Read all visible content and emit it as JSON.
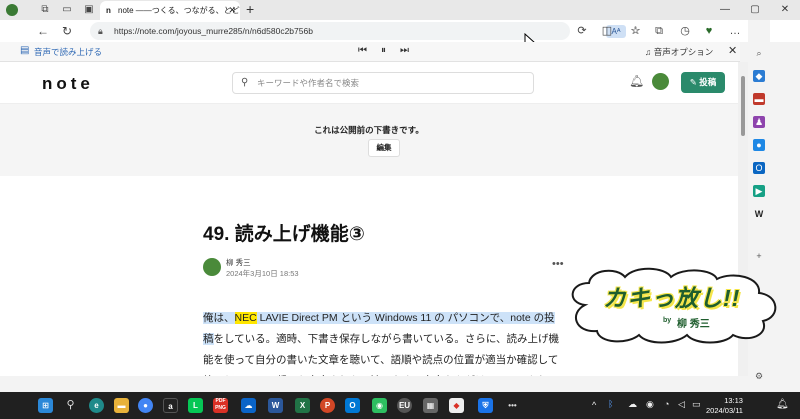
{
  "browser": {
    "tab_title": "note ――つくる、つながる、とどける。",
    "tab_favicon": "n",
    "url": "https://note.com/joyous_murre285/n/n6d580c2b756b",
    "readaloud_icon_text": "Aᴬ"
  },
  "read_aloud_bar": {
    "label": "音声で読み上げる",
    "options_label": "音声オプション"
  },
  "site": {
    "logo": "note",
    "search_placeholder": "キーワードや作者名で検索",
    "post_button": "投稿"
  },
  "draft": {
    "message": "これは公開前の下書きです。",
    "edit_button": "編集"
  },
  "article": {
    "title": "49. 読み上げ機能③",
    "author": "柳 秀三",
    "date": "2024年3月10日 18:53",
    "body_line1_pre": "俺は、",
    "body_line1_nec": "NEC",
    "body_line1_post": " LAVIE Direct PM という Windows 11 の パソコンで、note の投稿",
    "body_rest": "をしている。適時、下書き保存しながら書いている。さらに、読み上げ機能を使って自分の書いた文章を聴いて、語順や読点の位置が適当か確認して校正している。凝った文章よりも、読みやすい文章を心がけているつもりだ。"
  },
  "overlay": {
    "title": "カキっ放し!!",
    "by": "by",
    "author": "柳 秀三"
  },
  "taskbar": {
    "icons": [
      "windows-icon",
      "search-icon",
      "edge-icon",
      "explorer-icon",
      "chrome-icon",
      "amazon-icon",
      "line-icon",
      "pdf-icon",
      "onedrive-icon",
      "word-icon",
      "excel-icon",
      "powerpoint-icon",
      "outlook-icon",
      "evernote-icon",
      "eu-icon",
      "app-icon",
      "maps-icon",
      "security-icon",
      "more-icon"
    ],
    "pdf_label": "PDF\nPNG",
    "eu_label": "EU",
    "time": "13:13",
    "date": "2024/03/11"
  },
  "colors": {
    "accent_green": "#2a8a6b",
    "highlight_blue": "#cde2f8",
    "highlight_yellow": "#ffe600",
    "overlay_green": "#1f5e2e",
    "overlay_yellow": "#f5e64a"
  }
}
